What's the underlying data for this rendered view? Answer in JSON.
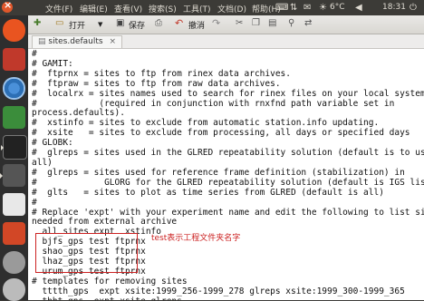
{
  "menubar": {
    "menu_items": [
      "文件(F)",
      "编辑(E)",
      "查看(V)",
      "搜索(S)",
      "工具(T)",
      "文档(D)",
      "帮助(H)"
    ],
    "weather": "6°C",
    "time": "18:31"
  },
  "toolbar": {
    "open_label": "打开",
    "save_label": "保存",
    "undo_label": "撤消"
  },
  "tab": {
    "title": "sites.defaults",
    "close": "×"
  },
  "editor": {
    "lines": [
      "#",
      "# GAMIT:",
      "#  ftprnx = sites to ftp from rinex data archives.",
      "#  ftpraw = sites to ftp from raw data archives.",
      "#  localrx = sites names used to search for rinex files on your local system.",
      "#            (required in conjunction with rnxfnd path variable set in",
      "process.defaults).",
      "#  xstinfo = sites to exclude from automatic station.info updating.",
      "#  xsite   = sites to exclude from processing, all days or specified days",
      "# GLOBK:",
      "#  glreps = sites used in the GLRED repeatability solution (default is to use",
      "all)",
      "#  glreps = sites used for reference frame definition (stabilization) in",
      "#             GLORG for the GLRED repeatability solution (default is IGS list)",
      "#  glts   = sites to plot as time series from GLRED (default is all)",
      "#",
      "# Replace 'expt' with your experiment name and edit the following to list sites",
      "needed from external archive",
      "  all_sites expt  xstinfo",
      "  bjfs_gps test ftprnx",
      "  shao_gps test ftprnx",
      "  lhaz_gps test ftprnx",
      "  urum_gps test ftprnx",
      "# templates for removing sites",
      "  tttth_gps  expt xsite:1999_256-1999_278 glreps xsite:1999_300-1999_365",
      "  thht_gps  expt xsite glreps"
    ],
    "note": "test表示工程文件夹名字"
  },
  "colors": {
    "annotation": "#cc2222",
    "launcher_bg": "#2e2e2e",
    "menubar_bg": "#3c3b37"
  }
}
